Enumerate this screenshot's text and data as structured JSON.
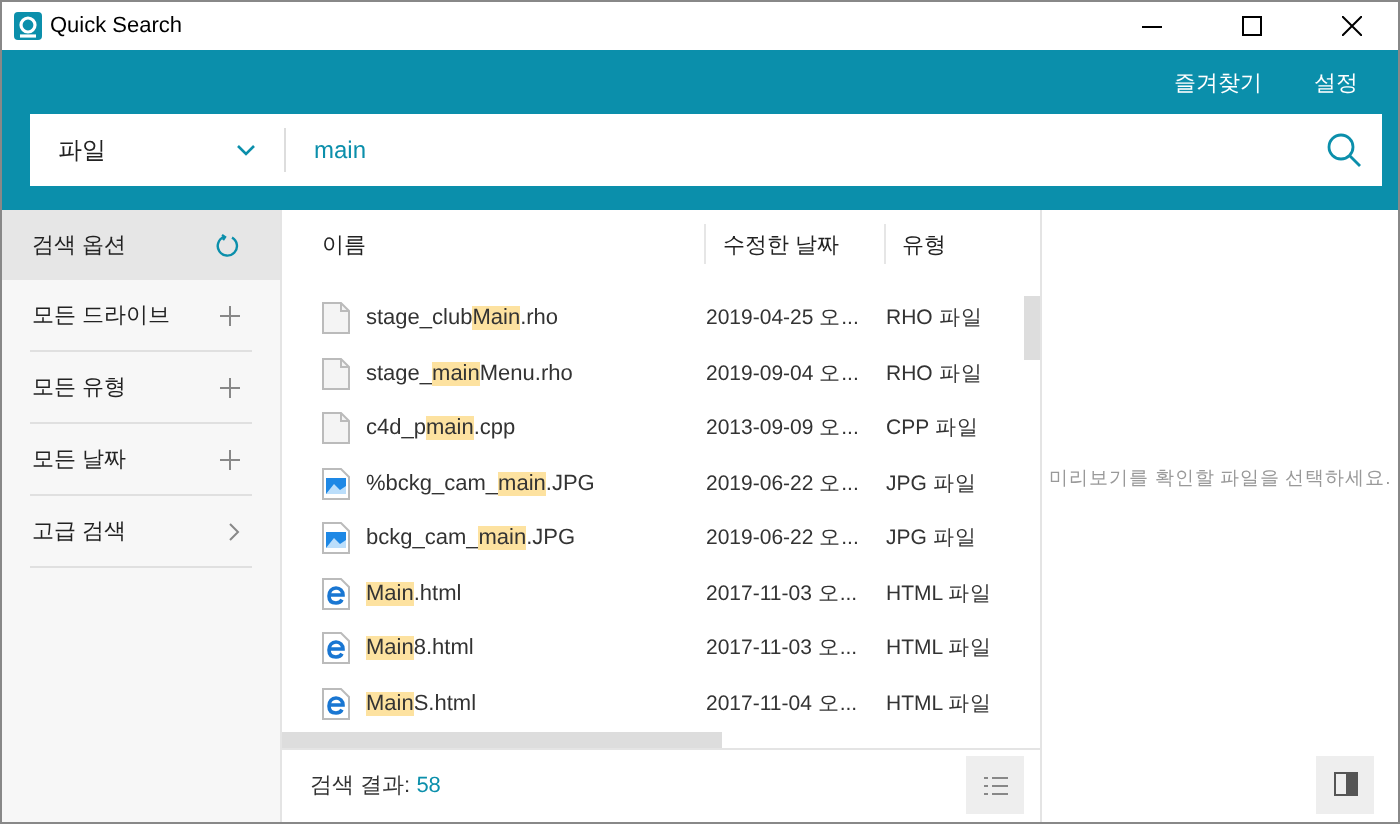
{
  "window": {
    "title": "Quick Search"
  },
  "header_links": [
    "즐겨찾기",
    "설정"
  ],
  "search": {
    "scope": "파일",
    "value": "main"
  },
  "sidebar": {
    "items": [
      {
        "label": "검색 옵션",
        "kind": "reset",
        "selected": true
      },
      {
        "label": "모든 드라이브",
        "kind": "expand",
        "selected": false
      },
      {
        "label": "모든 유형",
        "kind": "expand",
        "selected": false
      },
      {
        "label": "모든 날짜",
        "kind": "expand",
        "selected": false
      },
      {
        "label": "고급 검색",
        "kind": "more",
        "selected": false
      }
    ]
  },
  "table": {
    "columns": [
      "이름",
      "수정한 날짜",
      "유형"
    ],
    "rows": [
      {
        "kind": "file",
        "name": [
          {
            "text": "stage_club",
            "highlighted": false
          },
          {
            "text": "Main",
            "highlighted": true
          },
          {
            "text": ".rho",
            "highlighted": false
          }
        ],
        "date": "2019-04-25 오...",
        "type": "RHO 파일"
      },
      {
        "kind": "file",
        "name": [
          {
            "text": "stage_",
            "highlighted": false
          },
          {
            "text": "main",
            "highlighted": true
          },
          {
            "text": "Menu.rho",
            "highlighted": false
          }
        ],
        "date": "2019-09-04 오...",
        "type": "RHO 파일"
      },
      {
        "kind": "file",
        "name": [
          {
            "text": "c4d_p",
            "highlighted": false
          },
          {
            "text": "main",
            "highlighted": true
          },
          {
            "text": ".cpp",
            "highlighted": false
          }
        ],
        "date": "2013-09-09 오...",
        "type": "CPP 파일"
      },
      {
        "kind": "image",
        "name": [
          {
            "text": "%bckg_cam_",
            "highlighted": false
          },
          {
            "text": "main",
            "highlighted": true
          },
          {
            "text": ".JPG",
            "highlighted": false
          }
        ],
        "date": "2019-06-22 오...",
        "type": "JPG 파일"
      },
      {
        "kind": "image",
        "name": [
          {
            "text": "bckg_cam_",
            "highlighted": false
          },
          {
            "text": "main",
            "highlighted": true
          },
          {
            "text": ".JPG",
            "highlighted": false
          }
        ],
        "date": "2019-06-22 오...",
        "type": "JPG 파일"
      },
      {
        "kind": "html",
        "name": [
          {
            "text": "Main",
            "highlighted": true
          },
          {
            "text": ".html",
            "highlighted": false
          }
        ],
        "date": "2017-11-03 오...",
        "type": "HTML 파일"
      },
      {
        "kind": "html",
        "name": [
          {
            "text": "Main",
            "highlighted": true
          },
          {
            "text": "8.html",
            "highlighted": false
          }
        ],
        "date": "2017-11-03 오...",
        "type": "HTML 파일"
      },
      {
        "kind": "html",
        "name": [
          {
            "text": "Main",
            "highlighted": true
          },
          {
            "text": "S.html",
            "highlighted": false
          }
        ],
        "date": "2017-11-04 오...",
        "type": "HTML 파일"
      }
    ]
  },
  "status": {
    "label": "검색 결과:",
    "count": "58"
  },
  "preview": {
    "message": "미리보기를 확인할 파일을 선택하세요."
  }
}
